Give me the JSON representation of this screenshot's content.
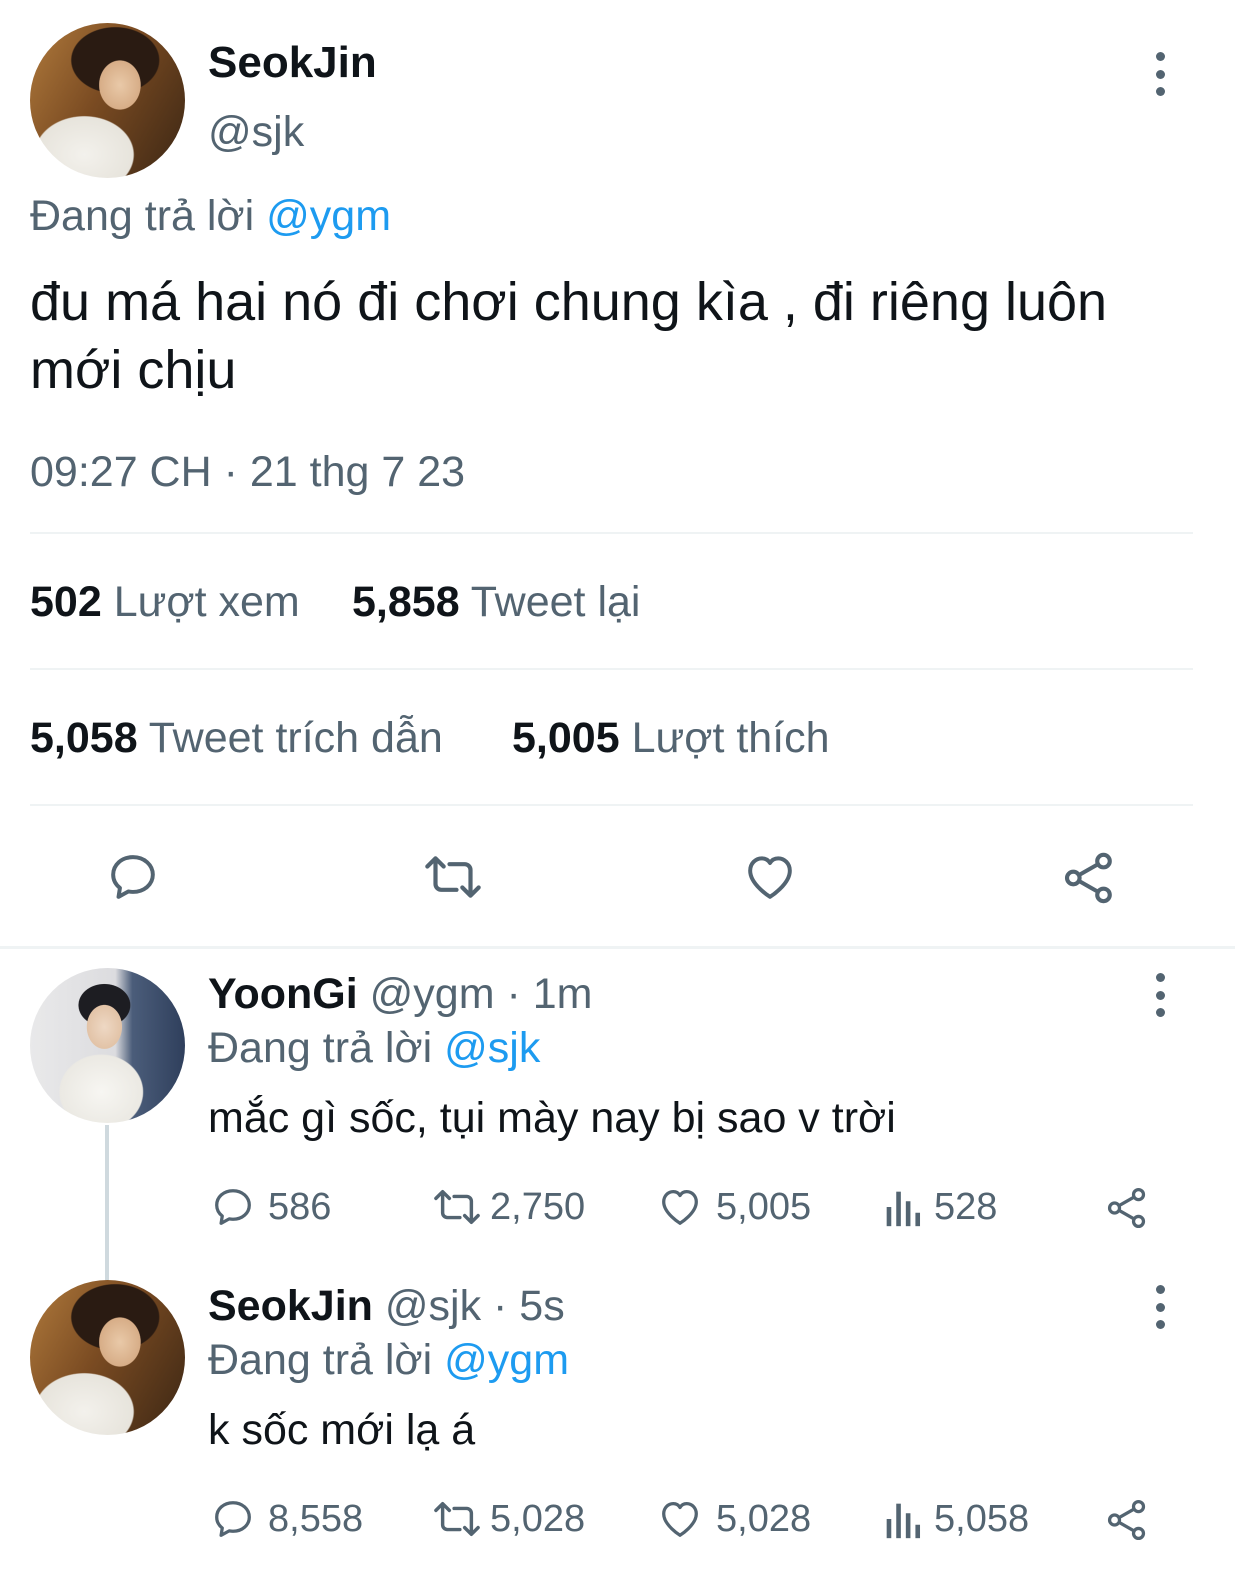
{
  "main_tweet": {
    "display_name": "SeokJin",
    "handle": "@sjk",
    "replying_label": "Đang trả lời",
    "replying_to": "@ygm",
    "text": "đu má hai nó đi chơi chung kìa , đi riêng luôn mới chịu",
    "timestamp": "09:27 CH · 21 thg 7 23",
    "stats": {
      "views_count": "502",
      "views_label": "Lượt xem",
      "retweets_count": "5,858",
      "retweets_label": "Tweet lại",
      "quotes_count": "5,058",
      "quotes_label": "Tweet trích dẫn",
      "likes_count": "5,005",
      "likes_label": "Lượt thích"
    },
    "actions": [
      "reply-icon",
      "retweet-icon",
      "like-icon",
      "share-icon"
    ]
  },
  "replies": [
    {
      "display_name": "YoonGi",
      "handle": "@ygm",
      "time": "· 1m",
      "replying_label": "Đang trả lời",
      "replying_to": "@sjk",
      "text": "mắc gì sốc, tụi mày nay bị sao v trời",
      "replies": "586",
      "retweets": "2,750",
      "likes": "5,005",
      "views": "528"
    },
    {
      "display_name": "SeokJin",
      "handle": "@sjk",
      "time": "· 5s",
      "replying_label": "Đang trả lời",
      "replying_to": "@ygm",
      "text": "k sốc mới lạ á",
      "replies": "8,558",
      "retweets": "5,028",
      "likes": "5,028",
      "views": "5,058"
    }
  ],
  "colors": {
    "text": "#0f1419",
    "muted": "#536471",
    "link": "#1d9bf0",
    "divider": "#eff3f4"
  }
}
